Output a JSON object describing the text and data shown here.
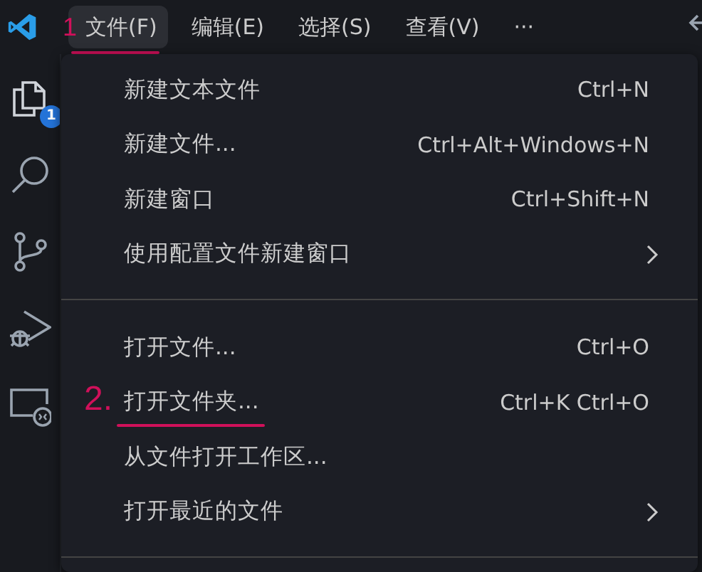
{
  "menu_bar": [
    {
      "label": "文件(F)",
      "selected": true,
      "annotation": "1"
    },
    {
      "label": "编辑(E)",
      "selected": false
    },
    {
      "label": "选择(S)",
      "selected": false
    },
    {
      "label": "查看(V)",
      "selected": false
    },
    {
      "label": "···",
      "selected": false
    }
  ],
  "activity_bar": [
    {
      "kind": "files",
      "badge": "1"
    },
    {
      "kind": "search"
    },
    {
      "kind": "branch"
    },
    {
      "kind": "debug"
    },
    {
      "kind": "remote"
    }
  ],
  "menu": [
    {
      "kind": "item",
      "label": "新建文本文件",
      "shortcut": "Ctrl+N"
    },
    {
      "kind": "item",
      "label": "新建文件...",
      "shortcut": "Ctrl+Alt+Windows+N"
    },
    {
      "kind": "item",
      "label": "新建窗口",
      "shortcut": "Ctrl+Shift+N"
    },
    {
      "kind": "submenu",
      "label": "使用配置文件新建窗口"
    },
    {
      "kind": "separator"
    },
    {
      "kind": "item",
      "label": "打开文件...",
      "shortcut": "Ctrl+O"
    },
    {
      "kind": "item",
      "label": "打开文件夹...",
      "shortcut": "Ctrl+K Ctrl+O",
      "annotation": "2."
    },
    {
      "kind": "item",
      "label": "从文件打开工作区..."
    },
    {
      "kind": "submenu",
      "label": "打开最近的文件"
    },
    {
      "kind": "separator"
    }
  ]
}
